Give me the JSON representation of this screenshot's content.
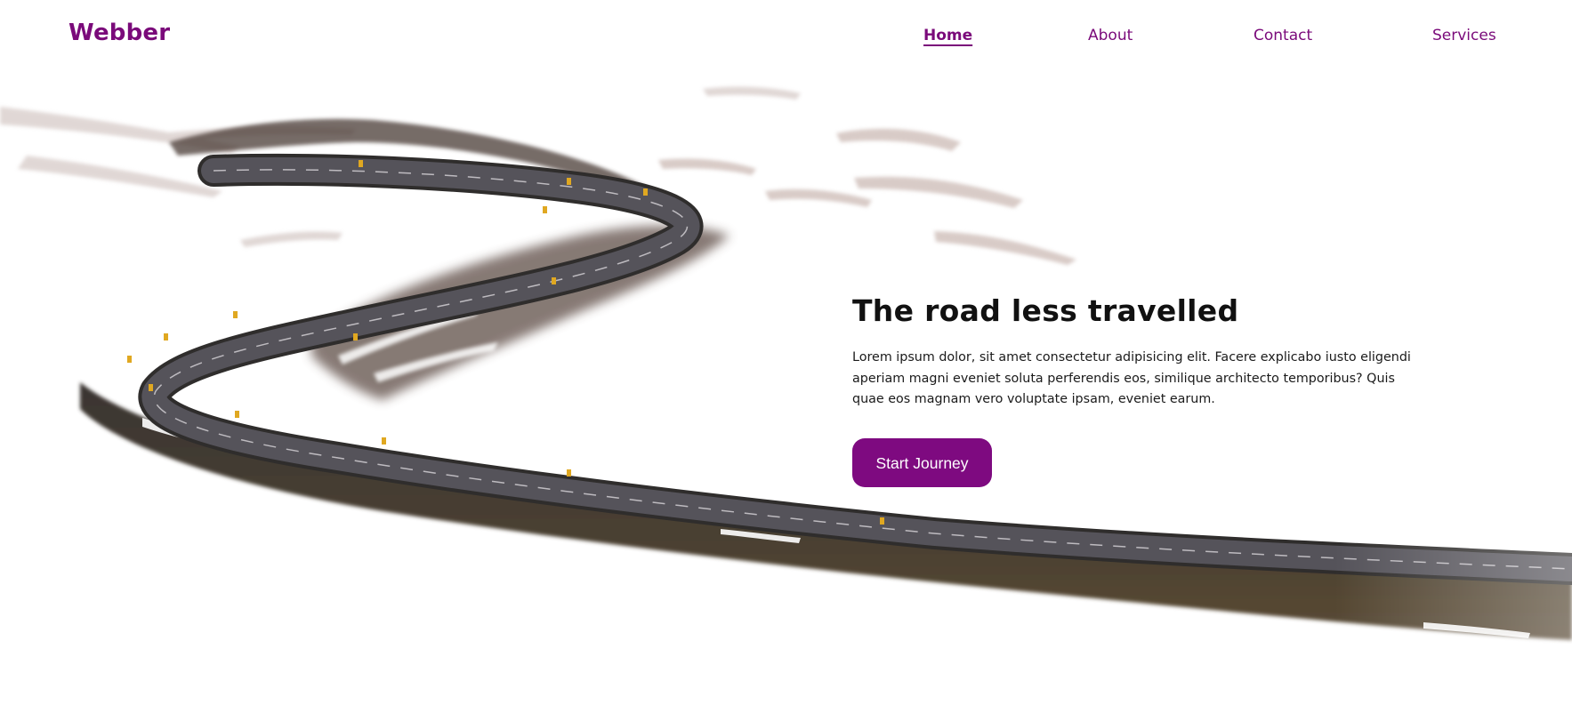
{
  "brand": {
    "name": "Webber",
    "accent_color": "#7e0a80"
  },
  "nav": {
    "items": [
      {
        "label": "Home",
        "active": true
      },
      {
        "label": "About",
        "active": false
      },
      {
        "label": "Contact",
        "active": false
      },
      {
        "label": "Services",
        "active": false
      }
    ]
  },
  "hero": {
    "title": "The road less travelled",
    "description": "Lorem ipsum dolor, sit amet consectetur adipisicing elit. Facere explicabo iusto eligendi aperiam magni eveniet soluta perferendis eos, similique architecto temporibus? Quis quae eos magnam vero voluptate ipsam, eveniet earum.",
    "cta_label": "Start Journey",
    "image": "winding-road-snow-landscape"
  }
}
